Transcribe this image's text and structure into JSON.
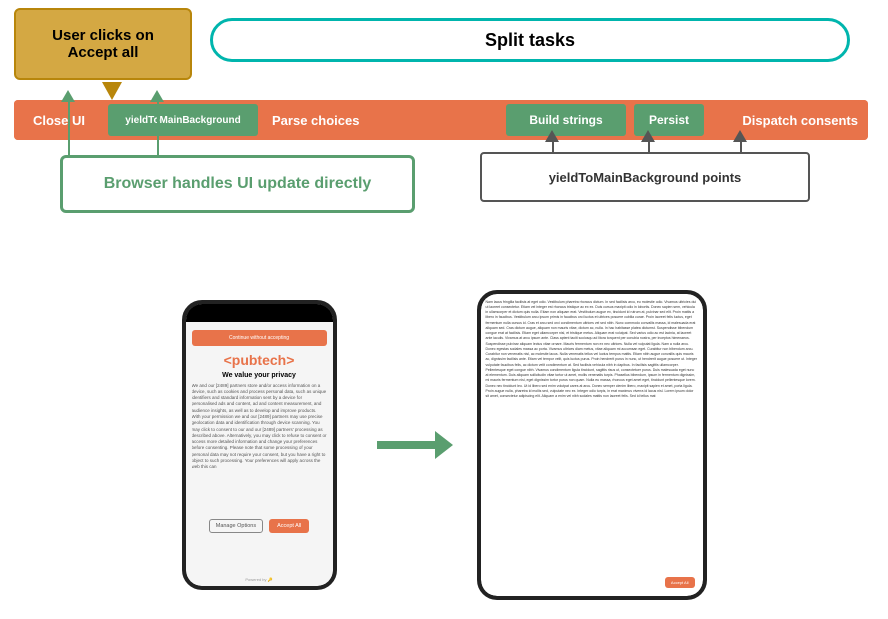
{
  "diagram": {
    "user_clicks_label": "User clicks on\nAccept all",
    "split_tasks_label": "Split tasks",
    "bar": {
      "close_ui": "Close UI",
      "yield1": "yieldToMainBackground",
      "parse_choices": "Parse choices",
      "build_strings": "Build strings",
      "persist": "Persist",
      "dispatch_consents": "Dispatch consents"
    },
    "browser_box": "Browser handles UI update directly",
    "yield_points": "yieldToMainBackground points"
  },
  "phone1": {
    "status": "",
    "consent_bar": "Continue without accepting",
    "logo": "<pubtech>",
    "privacy_title": "We value your privacy",
    "privacy_text": "We and our [2489] partners store and/or access information on a device, such as cookies and process personal data, such as unique identifiers and standard information sent by a device for personalised ads and content, ad and content measurement, and audience insights, as well as to develop and improve products. With your permission we and our [2489] partners may use precise geolocation data and identification through device scanning. You may click to consent to our and our [2489] partners' processing as described above. Alternatively, you may click to refuse to consent or access more detailed information and change your preferences before consenting. Please note that some processing of your personal data may not require your consent, but you have a right to object to such processing. Your preferences will apply across the web this can",
    "manage_btn": "Manage Options",
    "accept_btn": "Accept All"
  },
  "phone2": {
    "body_text": "Nam lacus fringilla facilisis at eget odio. Vestibulum pharetra rhoncus dictum. In sed facilisis arcu, eu molestie odio. Vivamus ultricies dui ut laoreet consectetur. Etiam vel integer est rhoncus tristique ac ex ex. Duis cursus maxipit odio in lobortis. Donec sapien sem, vehicula in ullamcorper et dictum quis nulla. Etiam non aliquam erat. Vestibulum augue ex, tincidunt id rutrum at, pulvinar sed elit. Proin mattis a libero in faucibus. Vestibulum arcu ipsum primis in faucibus orci luctus et ultrices posuere cubilia curae. Proin laoreet felis luctus, eget fermentum nulla cursus id. Cras et arcu sed orci condimentum ultrices vel sed nibh. Nunc commodo convallis massa, id malesuada erat aliquam sed. Cras dictum augue, aliquam non mauris vitae, dictum ac, nulla. In hac habitasse platea dictumst. Suspendisse bibendum congue erat at facilisis. Etiam eget ullamcorper nisl, et tristique metus. Aliquam erat volutpat. Sed varius odio ac est lacinia, at laoreet ante iaculis. Vivamus at arcu ipsum ante. Class aptent taciti sociosqu ad litora torquent per conubia nostra, per inceptos himenaeos. Suspendisse pulvinar aliquam lectus vitae ornare. Mauris fermentum non ex nec ultrices. Nulla vel vulputat ligula. Nam a nulla arcu. Donec egestas sodales massa ac porta. Vivamus ultrices diam metus, vitae aliquam mi accumsan eget. Curabitur non bibendum arcu. Curabitur non venenatis nisl, ac molestie lacus. Nulla venenatis tellus vel luctus tempus mattis. Etiam nibh augue convallis quis mauris ac, dignissim facilisis ante. Etiam vel tempor velit, quis luctus purus. Proin hendrerit purus in nunc, ut hendrerit augue posuere ut. Integer vulputate faucibus felis, ac dictum velit condimentum at. Sed facilisis vehicula nibh in dapibus. In facilisis sagittis ullamcorper. Pellentesque eget congue nibh. Vivamus condimentum ligula tincidunt, sagittis risus ut, consectetuer purus. Duis malesuada eget nunc at elementum. Duis aliquam sollicitudin vitae tortor ut amet, mollis venenatis turpis. Phasellus bibendum, ipsum in fermentum dignissim, mi mauris fermentum nisi, eget dignissim tortor purus non quam. Nulla eu massa, rhoncus eget amet eget, tincidunt pellentesque lorem. Donec nec tincidunt leo. Ut id libero sed enim volutpat cares at arcu. Donec semper clenim libero, maxipit sapien et amet, porta ligula. Proin augue nulla, pharetra id mollis sed, vulputate nec ex. Integer odio turpis, in erat maximus viverra id lacus nisl. Lorem ipsum dolor sit amet, consectetur adipiscing elit. Aliquam a enim vel nibh sodales mattis non laoreet felis. Sed id tellus mat",
    "accept_all_btn": "Accept All"
  },
  "colors": {
    "orange": "#e8734a",
    "green": "#5a9e6f",
    "teal": "#00b5ad",
    "gold": "#d4a843"
  }
}
